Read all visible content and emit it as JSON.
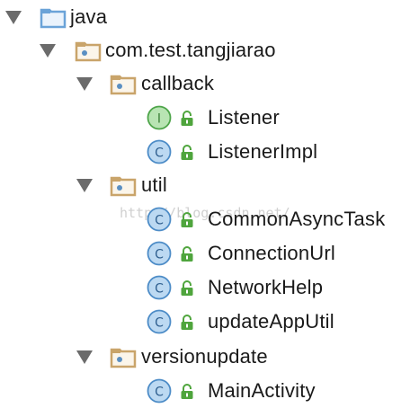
{
  "tree": {
    "root": {
      "label": "java",
      "icon": "source-folder-icon"
    },
    "package": {
      "label": "com.test.tangjiarao",
      "icon": "package-folder-icon"
    },
    "callback": {
      "label": "callback",
      "icon": "package-folder-icon",
      "items": [
        {
          "label": "Listener",
          "kind": "I",
          "icon": "interface-icon"
        },
        {
          "label": "ListenerImpl",
          "kind": "C",
          "icon": "class-icon"
        }
      ]
    },
    "util": {
      "label": "util",
      "icon": "package-folder-icon",
      "items": [
        {
          "label": "CommonAsyncTask",
          "kind": "C",
          "icon": "class-icon"
        },
        {
          "label": "ConnectionUrl",
          "kind": "C",
          "icon": "class-icon"
        },
        {
          "label": "NetworkHelp",
          "kind": "C",
          "icon": "class-icon"
        },
        {
          "label": "updateAppUtil",
          "kind": "C",
          "icon": "class-icon"
        }
      ]
    },
    "versionupdate": {
      "label": "versionupdate",
      "icon": "package-folder-icon",
      "items": [
        {
          "label": "MainActivity",
          "kind": "C",
          "icon": "class-icon"
        }
      ]
    }
  },
  "watermark": "http://blog.csdn.net/",
  "colors": {
    "class_fill": "#bcd9f2",
    "class_stroke": "#4d8cc7",
    "interface_fill": "#b8e4b3",
    "interface_stroke": "#4ea54a",
    "lock": "#4fa53d",
    "folder": "#c9a46a",
    "source_folder": "#6aa3d8"
  }
}
